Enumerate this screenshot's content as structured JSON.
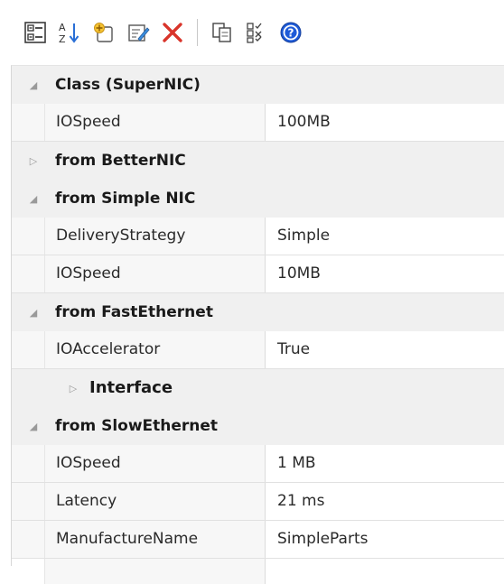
{
  "toolbar": {
    "buttons": [
      {
        "icon": "categorized-view-icon"
      },
      {
        "icon": "alphabetical-sort-icon"
      },
      {
        "icon": "new-property-icon"
      },
      {
        "icon": "edit-property-icon"
      },
      {
        "icon": "delete-icon"
      },
      {
        "icon": "copy-icon"
      },
      {
        "icon": "filter-icon"
      },
      {
        "icon": "help-icon"
      }
    ],
    "accent": "#1e5bd8",
    "delete_color": "#d9352b"
  },
  "grid": {
    "sections": [
      {
        "label": "Class (SuperNIC)",
        "expanded": true,
        "props": [
          {
            "name": "IOSpeed",
            "value": "100MB"
          }
        ]
      },
      {
        "label": "from BetterNIC",
        "expanded": false,
        "props": []
      },
      {
        "label": "from Simple NIC",
        "expanded": true,
        "props": [
          {
            "name": "DeliveryStrategy",
            "value": "Simple"
          },
          {
            "name": "IOSpeed",
            "value": "10MB"
          }
        ]
      },
      {
        "label": "from FastEthernet",
        "expanded": true,
        "props": [
          {
            "name": "IOAccelerator",
            "value": "True"
          }
        ],
        "subgroup": {
          "label": "Interface",
          "expanded": false
        }
      },
      {
        "label": "from SlowEthernet",
        "expanded": true,
        "props": [
          {
            "name": "IOSpeed",
            "value": "1 MB"
          },
          {
            "name": "Latency",
            "value": "21 ms"
          },
          {
            "name": "ManufactureName",
            "value": "SimpleParts"
          }
        ]
      }
    ]
  }
}
